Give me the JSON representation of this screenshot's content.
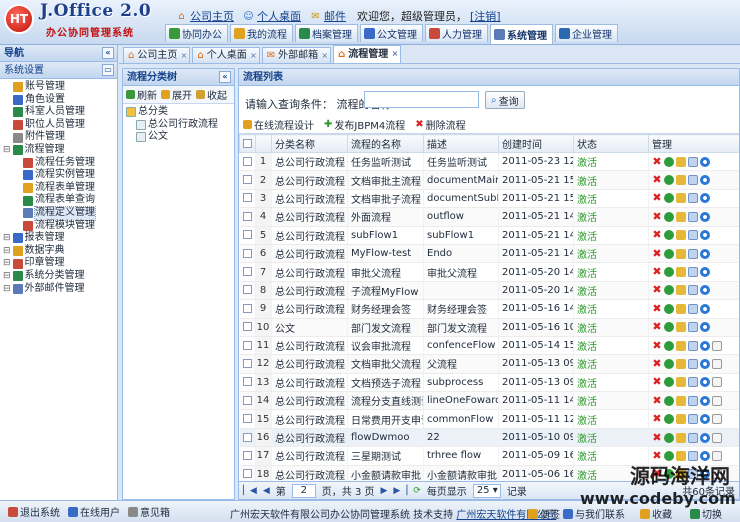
{
  "header": {
    "logo_mark": "HT",
    "logo_title": "J.Office 2.0",
    "logo_subtitle": "办公协同管理系统",
    "links": [
      "公司主页",
      "个人桌面",
      "邮件"
    ],
    "welcome": "欢迎您，超级管理员，",
    "logout": "[注销]"
  },
  "nav_tabs": [
    {
      "label": "协同办公",
      "color": "#3a9a3a"
    },
    {
      "label": "我的流程",
      "color": "#e0a020"
    },
    {
      "label": "档案管理",
      "color": "#2a8a4a"
    },
    {
      "label": "公文管理",
      "color": "#3a6ac8"
    },
    {
      "label": "人力管理",
      "color": "#c84a3a"
    },
    {
      "label": "系统管理",
      "color": "#5a7ab8"
    },
    {
      "label": "企业管理",
      "color": "#2a6ab0"
    }
  ],
  "left_nav": {
    "title": "导航",
    "items": [
      {
        "label": "系统设置",
        "level": 0,
        "color": "#5a7ab8"
      },
      {
        "label": "账号管理",
        "level": 1,
        "color": "#e0a020"
      },
      {
        "label": "角色设置",
        "level": 1,
        "color": "#3a6ac8"
      },
      {
        "label": "科室人员管理",
        "level": 1,
        "color": "#2a8a4a"
      },
      {
        "label": "职位人员管理",
        "level": 1,
        "color": "#c84a3a"
      },
      {
        "label": "附件管理",
        "level": 1,
        "color": "#8a8a8a"
      },
      {
        "label": "流程管理",
        "level": 0,
        "color": "#2a8a4a"
      },
      {
        "label": "流程任务管理",
        "level": 2,
        "color": "#c84a3a"
      },
      {
        "label": "流程实例管理",
        "level": 2,
        "color": "#3a6ac8"
      },
      {
        "label": "流程表单管理",
        "level": 2,
        "color": "#e0a020"
      },
      {
        "label": "流程表单查询",
        "level": 2,
        "color": "#2a8a4a"
      },
      {
        "label": "流程定义管理",
        "level": 2,
        "color": "#5a7ab8",
        "selected": true
      },
      {
        "label": "流程模块管理",
        "level": 2,
        "color": "#c84a3a"
      },
      {
        "label": "报表管理",
        "level": 0,
        "color": "#3a6ac8"
      },
      {
        "label": "数据字典",
        "level": 0,
        "color": "#e0a020"
      },
      {
        "label": "印章管理",
        "level": 0,
        "color": "#c84a3a"
      },
      {
        "label": "系统分类管理",
        "level": 0,
        "color": "#2a8a4a"
      },
      {
        "label": "外部邮件管理",
        "level": 0,
        "color": "#5a7ab8"
      }
    ]
  },
  "content_tabs": [
    {
      "label": "公司主页",
      "active": false
    },
    {
      "label": "个人桌面",
      "active": false
    },
    {
      "label": "外部邮箱",
      "active": false
    },
    {
      "label": "流程管理",
      "active": true
    }
  ],
  "category_panel": {
    "title": "流程分类树",
    "buttons": [
      "刷新",
      "展开",
      "收起"
    ],
    "tree": [
      {
        "label": "总分类",
        "level": 0
      },
      {
        "label": "总公司行政流程",
        "level": 1
      },
      {
        "label": "公文",
        "level": 1
      }
    ]
  },
  "list_panel": {
    "title": "流程列表",
    "search_label": "请输入查询条件：  流程的名称",
    "search_value": "",
    "search_button": "查询",
    "actions": [
      "在线流程设计",
      "发布JBPM4流程",
      "删除流程"
    ],
    "columns": [
      "",
      "",
      "分类名称",
      "流程的名称",
      "描述",
      "创建时间",
      "状态",
      "管理"
    ],
    "rows": [
      {
        "n": "1",
        "cat": "总公司行政流程",
        "name": "任务监听测试",
        "desc": "任务监听测试",
        "time": "2011-05-23 12:24:",
        "status": "激活",
        "extra": 0
      },
      {
        "n": "2",
        "cat": "总公司行政流程",
        "name": "文档审批主流程",
        "desc": "documentMainFlow",
        "time": "2011-05-21 15:28:",
        "status": "激活",
        "extra": 0
      },
      {
        "n": "3",
        "cat": "总公司行政流程",
        "name": "文档审批子流程",
        "desc": "documentSubFlow",
        "time": "2011-05-21 15:27:",
        "status": "激活",
        "extra": 0
      },
      {
        "n": "4",
        "cat": "总公司行政流程",
        "name": "外面流程",
        "desc": "outflow",
        "time": "2011-05-21 14:46:",
        "status": "激活",
        "extra": 0
      },
      {
        "n": "5",
        "cat": "总公司行政流程",
        "name": "subFlow1",
        "desc": "subFlow1",
        "time": "2011-05-21 14:30:",
        "status": "激活",
        "extra": 0
      },
      {
        "n": "6",
        "cat": "总公司行政流程",
        "name": "MyFlow-test",
        "desc": "Endo",
        "time": "2011-05-21 14:30:",
        "status": "激活",
        "extra": 0
      },
      {
        "n": "7",
        "cat": "总公司行政流程",
        "name": "审批父流程",
        "desc": "审批父流程",
        "time": "2011-05-20 14:48:",
        "status": "激活",
        "extra": 0
      },
      {
        "n": "8",
        "cat": "总公司行政流程",
        "name": "子流程MyFlow",
        "desc": "",
        "time": "2011-05-20 14:45:",
        "status": "激活",
        "extra": 0
      },
      {
        "n": "9",
        "cat": "总公司行政流程",
        "name": "财务经理会签",
        "desc": "财务经理会签",
        "time": "2011-05-16 14:45:",
        "status": "激活",
        "extra": 0
      },
      {
        "n": "10",
        "cat": "公文",
        "name": "部门发文流程",
        "desc": "部门发文流程",
        "time": "2011-05-16 10:55:",
        "status": "激活",
        "extra": 0
      },
      {
        "n": "11",
        "cat": "总公司行政流程",
        "name": "议会审批流程",
        "desc": "confenceFlow",
        "time": "2011-05-14 15:42:",
        "status": "激活",
        "extra": 1
      },
      {
        "n": "12",
        "cat": "总公司行政流程",
        "name": "文档审批父流程",
        "desc": "父流程",
        "time": "2011-05-13 09:10:",
        "status": "激活",
        "extra": 1
      },
      {
        "n": "13",
        "cat": "总公司行政流程",
        "name": "文档预选子流程",
        "desc": "subprocess",
        "time": "2011-05-13 09:08:",
        "status": "激活",
        "extra": 1
      },
      {
        "n": "14",
        "cat": "总公司行政流程",
        "name": "流程分支直线测试",
        "desc": "lineOneFoward",
        "time": "2011-05-11 14:58:",
        "status": "激活",
        "extra": 1
      },
      {
        "n": "15",
        "cat": "总公司行政流程",
        "name": "日常费用开支申请",
        "desc": "commonFlow",
        "time": "2011-05-11 12:35:",
        "status": "激活",
        "extra": 1
      },
      {
        "n": "16",
        "cat": "总公司行政流程",
        "name": "flowDwmoo",
        "desc": "22",
        "time": "2011-05-10 09:03:",
        "status": "激活",
        "extra": 1
      },
      {
        "n": "17",
        "cat": "总公司行政流程",
        "name": "三星期测试",
        "desc": "trhree flow",
        "time": "2011-05-09 16:24:",
        "status": "激活",
        "extra": 1
      },
      {
        "n": "18",
        "cat": "总公司行政流程",
        "name": "小金额请款审批",
        "desc": "小金额请款审批",
        "time": "2011-05-06 16:20:",
        "status": "激活",
        "extra": 1
      }
    ],
    "pager": {
      "page_label": "第",
      "page_value": "2",
      "total_label": "页，共 3 页",
      "per_page_label": "每页显示",
      "per_page_value": "25",
      "records_label": "记录",
      "summary": "共60条记录"
    }
  },
  "footer": {
    "items": [
      "退出系统",
      "在线用户",
      "意见箱"
    ],
    "copyright_text": "广州宏天软件有限公司办公协同管理系统  技术支持",
    "copyright_link": "广州宏天软件有限公司",
    "right_items": [
      "便签",
      "与我们联系",
      "收藏",
      "切换"
    ]
  },
  "watermark": {
    "line1": "源码海洋网",
    "line2": "www.codeby.com"
  }
}
